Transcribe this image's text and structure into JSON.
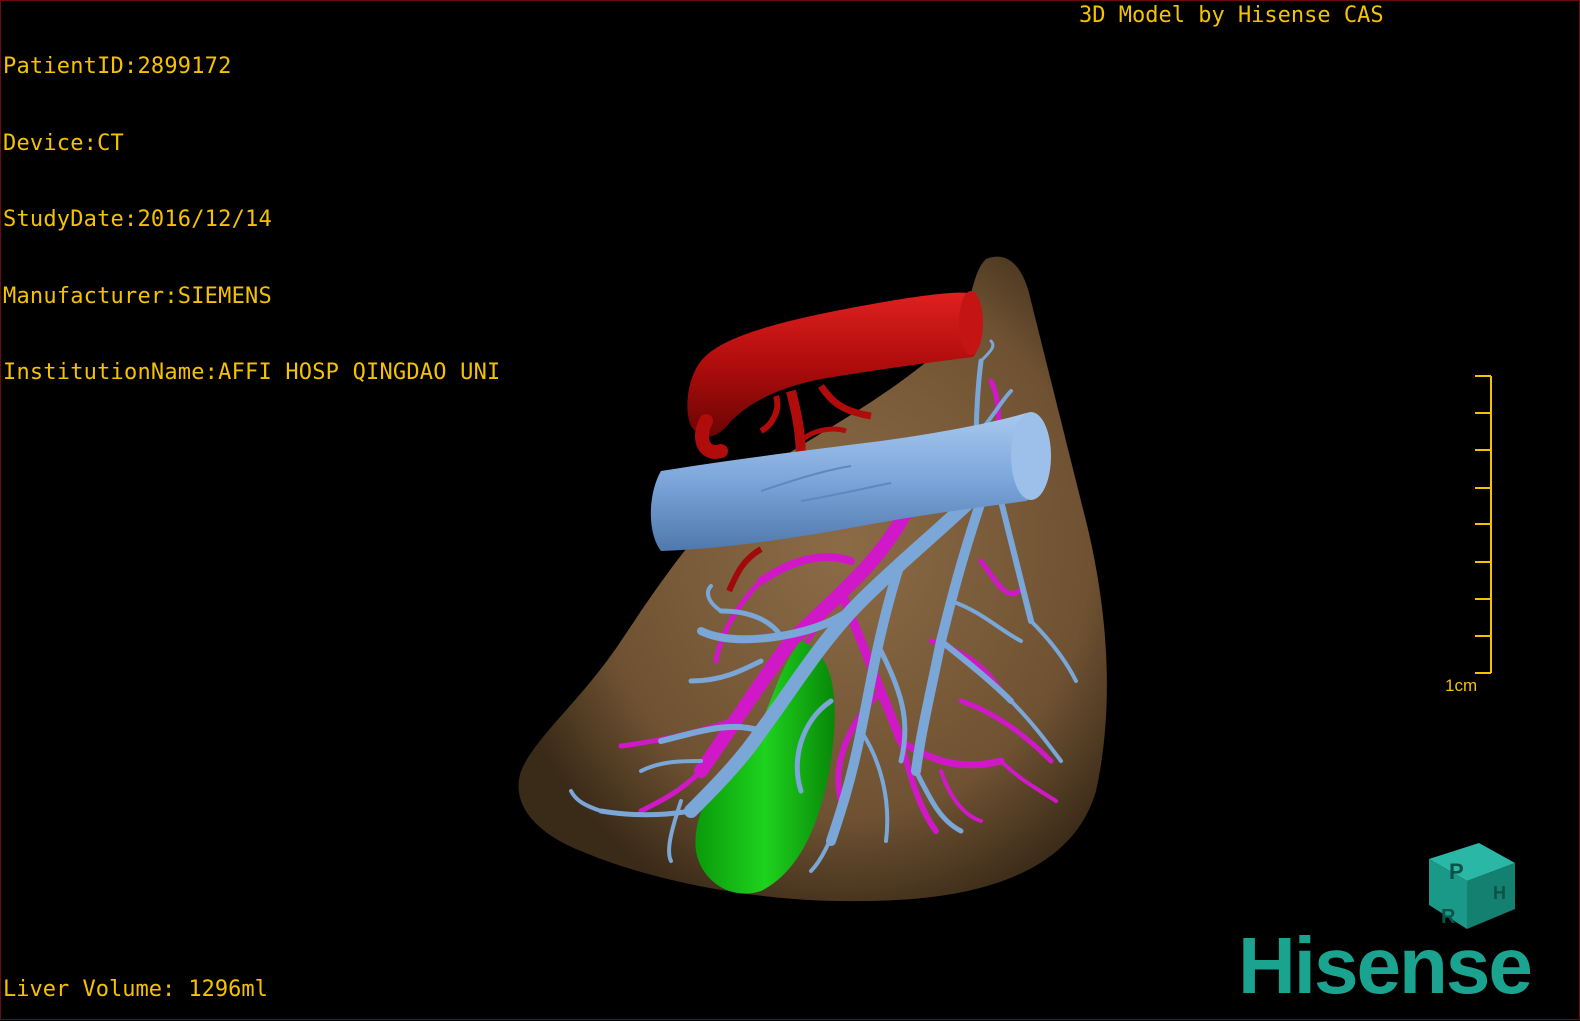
{
  "header": {
    "patient_id": "PatientID:2899172",
    "device": "Device:CT",
    "study_date": "StudyDate:2016/12/14",
    "manufacturer": "Manufacturer:SIEMENS",
    "institution": "InstitutionName:AFFI HOSP QINGDAO UNI"
  },
  "title": "3D Model by Hisense CAS",
  "scale_bar": {
    "label": "1cm",
    "ticks": 9
  },
  "liver_volume": "Liver Volume: 1296ml",
  "orientation_cube": {
    "face_top": "P",
    "face_side": "H",
    "face_front": "R"
  },
  "brand": "Hisense",
  "colors": {
    "overlay_text": "#f5c200",
    "liver": "#7a5a38",
    "artery": "#c01010",
    "vein": "#7aa6d8",
    "portal_vein": "#d018c8",
    "gallbladder": "#10c010",
    "brand": "#1aa38f"
  },
  "structures": [
    "liver-surface",
    "aorta",
    "inferior-vena-cava",
    "hepatic-veins",
    "portal-veins",
    "gallbladder"
  ]
}
